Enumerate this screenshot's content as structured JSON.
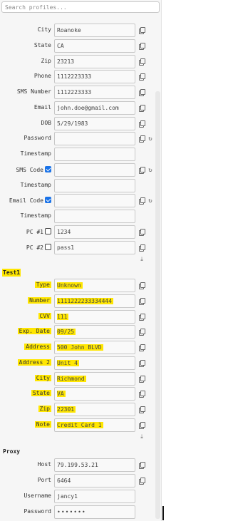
{
  "search": {
    "placeholder": "Search profiles..."
  },
  "profile_fields": [
    {
      "label": "City",
      "value": "Roanoke",
      "copy": true
    },
    {
      "label": "State",
      "value": "CA",
      "copy": true
    },
    {
      "label": "Zip",
      "value": "23213",
      "copy": true
    },
    {
      "label": "Phone",
      "value": "1112223333",
      "copy": true
    },
    {
      "label": "SMS Number",
      "value": "1112223333",
      "copy": true
    },
    {
      "label": "Email",
      "value": "john.doe@gmail.com",
      "copy": true
    },
    {
      "label": "DOB",
      "value": "5/29/1983",
      "copy": true
    },
    {
      "label": "Password",
      "value": "",
      "copy": true,
      "refresh": true
    },
    {
      "label": "Timestamp",
      "value": ""
    },
    {
      "label": "SMS Code",
      "value": "",
      "checkbox": true,
      "checked": true,
      "copy": true,
      "refresh": true
    },
    {
      "label": "Timestamp",
      "value": ""
    },
    {
      "label": "Email Code",
      "value": "",
      "checkbox": true,
      "checked": true,
      "copy": true,
      "refresh": true
    },
    {
      "label": "Timestamp",
      "value": ""
    },
    {
      "label": "PC #1",
      "value": "1234",
      "checkbox": true,
      "checked": false,
      "copy": true
    },
    {
      "label": "PC #2",
      "value": "pass1",
      "checkbox": true,
      "checked": false,
      "copy": true
    }
  ],
  "card_section": {
    "title": "Test1",
    "fields": [
      {
        "label": "Type",
        "value": "Unknown"
      },
      {
        "label": "Number",
        "value": "1111222233334444"
      },
      {
        "label": "CVV",
        "value": "111"
      },
      {
        "label": "Exp. Date",
        "value": "09/25"
      },
      {
        "label": "Address",
        "value": "500 John BLVD"
      },
      {
        "label": "Address 2",
        "value": "Unit 4"
      },
      {
        "label": "City",
        "value": "Richmond"
      },
      {
        "label": "State",
        "value": "VA"
      },
      {
        "label": "Zip",
        "value": "22301"
      },
      {
        "label": "Note",
        "value": "Credit Card 1"
      }
    ]
  },
  "proxy_section": {
    "title": "Proxy",
    "fields": [
      {
        "label": "Host",
        "value": "79.199.53.21"
      },
      {
        "label": "Port",
        "value": "6464"
      },
      {
        "label": "Username",
        "value": "jancy1"
      },
      {
        "label": "Password",
        "value": "•••••••"
      }
    ]
  },
  "icons": {
    "copy": "copy-icon",
    "refresh": "refresh-icon",
    "download": "download-icon"
  },
  "colors": {
    "highlight": "#ffe600",
    "checkbox": "#1a73e8"
  }
}
